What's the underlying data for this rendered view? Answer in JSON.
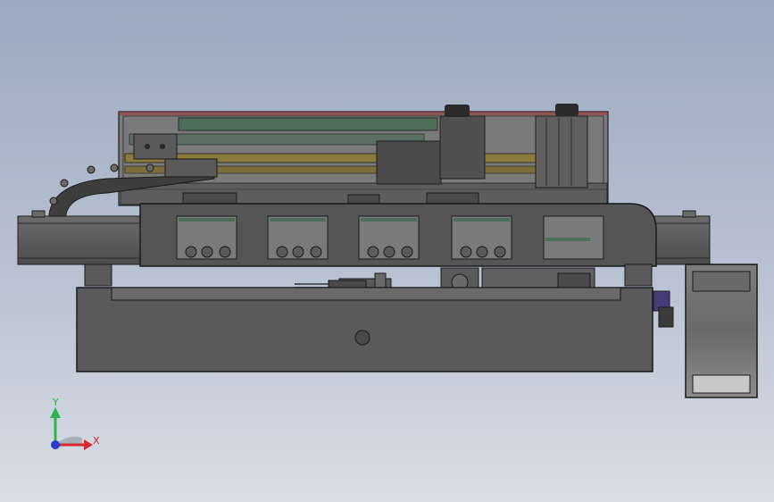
{
  "viewport": {
    "background_top": "#9ba8bf",
    "background_bottom": "#d9dde5",
    "part_color": "#5a5a5a",
    "part_dark": "#3f3f3f",
    "edge_color": "#1e1e1e",
    "rail_green": "#4f6e5a",
    "rail_yellow": "#8a7a3e",
    "accent_red": "#a03030",
    "accent_purple": "#4b3a7a"
  },
  "triad": {
    "x_label": "X",
    "y_label": "Y",
    "x_color": "#d42a2a",
    "y_color": "#2db34a",
    "z_color": "#2a3ccf",
    "icon": "coordinate-triad-icon"
  }
}
